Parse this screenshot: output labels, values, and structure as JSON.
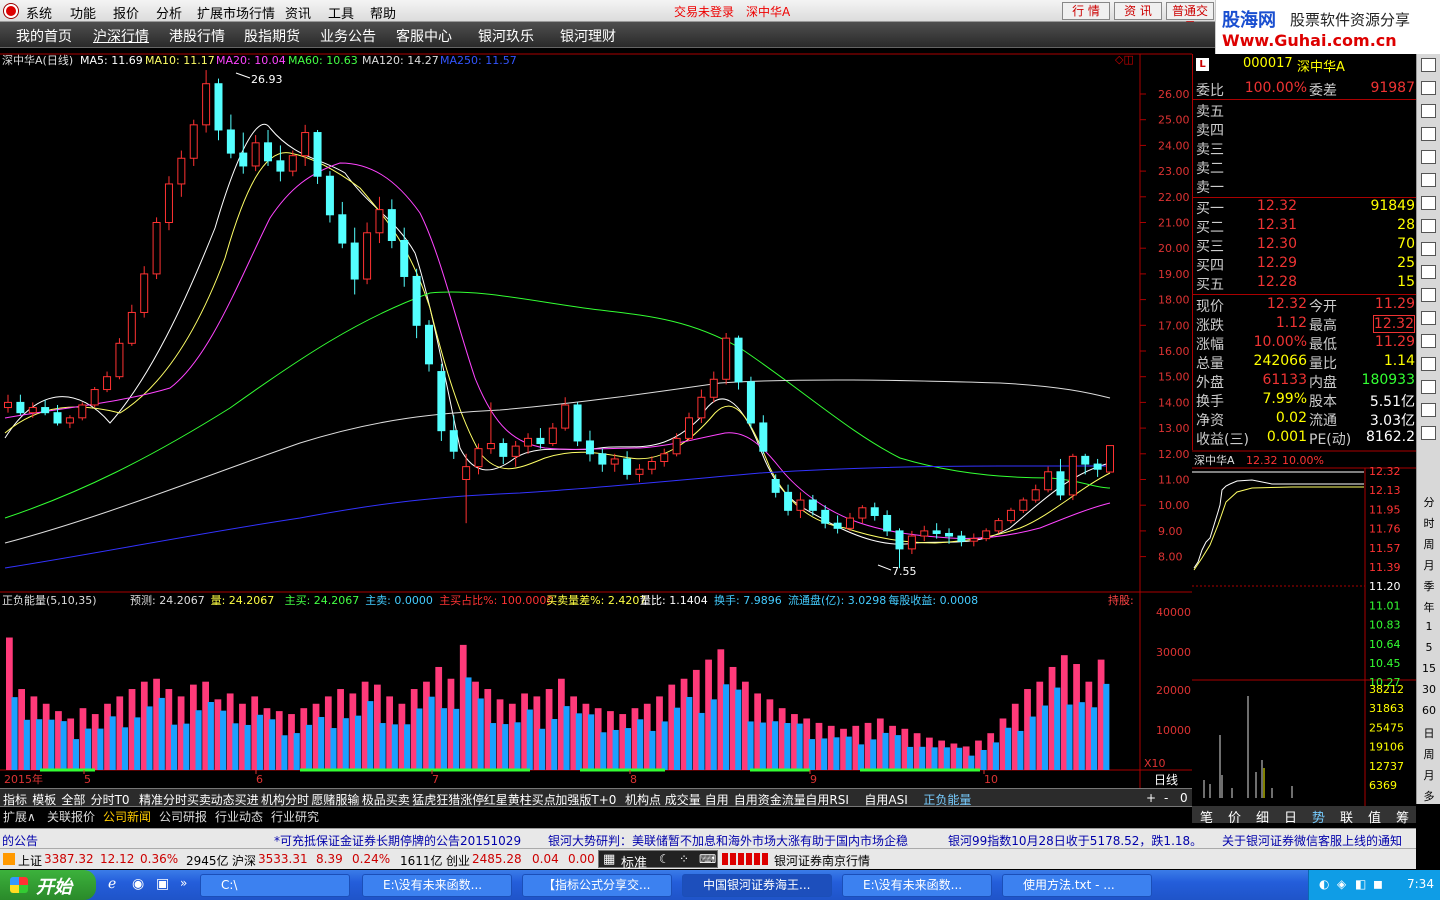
{
  "menubar": {
    "items": [
      "系统",
      "功能",
      "报价",
      "分析",
      "扩展市场行情",
      "资讯",
      "工具",
      "帮助"
    ],
    "trade_status": "交易未登录",
    "stock_name": "深中华A",
    "buttons": [
      "行 情",
      "资 讯",
      "普通交易"
    ]
  },
  "brand": {
    "name": "股海网",
    "slogan": "股票软件资源分享",
    "url": "Www.Guhai.com.cn"
  },
  "nav": {
    "items": [
      "我的首页",
      "沪深行情",
      "港股行情",
      "股指期货",
      "业务公告",
      "客服中心",
      "银河玖乐",
      "银河理财"
    ],
    "active": 1
  },
  "chart_header": {
    "title": "深中华A(日线)",
    "ma": [
      {
        "label": "MA5: 11.69",
        "color": "#ffffff"
      },
      {
        "label": "MA10: 11.17",
        "color": "#ffff66"
      },
      {
        "label": "MA20: 10.04",
        "color": "#ff44ff"
      },
      {
        "label": "MA60: 10.63",
        "color": "#44ff44"
      },
      {
        "label": "MA120: 14.27",
        "color": "#dddddd"
      },
      {
        "label": "MA250: 11.57",
        "color": "#3355ff"
      }
    ],
    "high_mark": "26.93",
    "low_mark": "7.55"
  },
  "price_axis": [
    "26.00",
    "25.00",
    "24.00",
    "23.00",
    "22.00",
    "21.00",
    "20.00",
    "19.00",
    "18.00",
    "17.00",
    "16.00",
    "15.00",
    "14.00",
    "13.00",
    "12.00",
    "11.00",
    "10.00",
    "9.00",
    "8.00"
  ],
  "vol_header": {
    "name": "正负能量(5,10,35)",
    "fields": [
      {
        "label": "预测: 24.2067",
        "color": "#dddddd"
      },
      {
        "label": "量: 24.2067",
        "color": "#ffff44"
      },
      {
        "label": "主买: 24.2067",
        "color": "#44ff44"
      },
      {
        "label": "主卖: 0.0000",
        "color": "#44ccff"
      },
      {
        "label": "主买占比%: 100.0000",
        "color": "#ff3333"
      },
      {
        "label": "买卖量差%: 2.4207",
        "color": "#ffff44"
      },
      {
        "label": "量比: 1.1404",
        "color": "#ffffff"
      },
      {
        "label": "换手: 7.9896",
        "color": "#44ccff"
      },
      {
        "label": "流通盘(亿): 3.0298",
        "color": "#44ccff"
      },
      {
        "label": "每股收益: 0.0008",
        "color": "#44ccff"
      }
    ],
    "hold_label": "持股:"
  },
  "vol_axis": [
    "40000",
    "30000",
    "20000",
    "10000"
  ],
  "vol_unit": "X10",
  "time_axis": [
    "2015年",
    "5",
    "6",
    "7",
    "8",
    "9",
    "10"
  ],
  "period_label": "日线",
  "quote": {
    "code": "000017",
    "name": "深中华A",
    "weibi_label": "委比",
    "weibi": "100.00%",
    "weicha_label": "委差",
    "weicha": "91987",
    "sell": [
      "卖五",
      "卖四",
      "卖三",
      "卖二",
      "卖一"
    ],
    "buy": [
      {
        "label": "买一",
        "price": "12.32",
        "vol": "91849"
      },
      {
        "label": "买二",
        "price": "12.31",
        "vol": "28"
      },
      {
        "label": "买三",
        "price": "12.30",
        "vol": "70"
      },
      {
        "label": "买四",
        "price": "12.29",
        "vol": "25"
      },
      {
        "label": "买五",
        "price": "12.28",
        "vol": "15"
      }
    ],
    "stats": [
      {
        "l1": "现价",
        "v1": "12.32",
        "l2": "今开",
        "v2": "11.29"
      },
      {
        "l1": "涨跌",
        "v1": "1.12",
        "l2": "最高",
        "v2": "12.32"
      },
      {
        "l1": "涨幅",
        "v1": "10.00%",
        "l2": "最低",
        "v2": "11.29"
      },
      {
        "l1": "总量",
        "v1": "242066",
        "l2": "量比",
        "v2": "1.14"
      },
      {
        "l1": "外盘",
        "v1": "61133",
        "l2": "内盘",
        "v2": "180933"
      },
      {
        "l1": "换手",
        "v1": "7.99%",
        "l2": "股本",
        "v2": "5.51亿"
      },
      {
        "l1": "净资",
        "v1": "0.02",
        "l2": "流通",
        "v2": "3.03亿"
      },
      {
        "l1": "收益(三)",
        "v1": "0.001",
        "l2": "PE(动)",
        "v2": "8162.2"
      }
    ]
  },
  "mini_chart": {
    "title": "深中华A",
    "price": "12.32",
    "pct": "10.00%",
    "axis": [
      "12.32",
      "12.13",
      "11.95",
      "11.76",
      "11.57",
      "11.39",
      "11.20",
      "11.01",
      "10.83",
      "10.64",
      "10.45",
      "10.27"
    ],
    "vol_axis": [
      "38212",
      "31863",
      "25475",
      "19106",
      "12737",
      "6369"
    ]
  },
  "right_tools": [
    "分",
    "时",
    "周",
    "月",
    "季",
    "年",
    "1",
    "5",
    "15",
    "30",
    "60",
    "日",
    "周",
    "月",
    "多",
    "季",
    "年"
  ],
  "tabs": [
    "指标",
    "模板",
    "全部",
    "分时T0",
    "精准分时买卖",
    "动态买进",
    "机构分时",
    "愿赌服输",
    "极品买卖",
    "猛虎狂猎涨停",
    "红星黄柱买点",
    "加强版T+0",
    "机构点",
    "成交量",
    "自用",
    "自用资金流量",
    "自用RSI",
    "自用ASI",
    "正负能量"
  ],
  "active_tab": "正负能量",
  "tab_controls": [
    "+",
    "-",
    "0"
  ],
  "tabs2": [
    "扩展∧",
    "关联报价",
    "公司新闻",
    "公司研报",
    "行业动态",
    "行业研究"
  ],
  "mini_tabs": [
    "笔",
    "价",
    "细",
    "日",
    "势",
    "联",
    "值",
    "筹"
  ],
  "news": [
    "的公告",
    "*可充抵保证金证券长期停牌的公告20151029",
    "银河大势研判：美联储暂不加息和海外市场大涨有助于国内市场企稳",
    "银河99指数10月28日收于5178.52，跌1.18。",
    "关于银河证券微信客服上线的通知"
  ],
  "index_bar": {
    "sh": {
      "name": "上证",
      "val": "3387.32",
      "chg": "12.12",
      "pct": "0.36%",
      "amt": "2945亿"
    },
    "hs": {
      "name": "沪深",
      "val": "3533.31",
      "chg": "8.39",
      "pct": "0.24%",
      "amt": "1611亿"
    },
    "cy": {
      "name": "创业",
      "val": "2485.28",
      "chg": "0.04",
      "pct": "0.00"
    },
    "mode": "标准",
    "broker": "银河证券南京行情"
  },
  "taskbar": {
    "start": "开始",
    "items": [
      "C:\\",
      "E:\\没有未来函数...",
      "【指标公式分享交...",
      "中国银河证券海王...",
      "E:\\没有未来函数...",
      "使用方法.txt - ..."
    ],
    "active": 3,
    "clock": "7:34"
  },
  "chart_data": {
    "type": "candlestick",
    "ylim": [
      7.3,
      27.5
    ],
    "candles": [
      [
        13.8,
        14.3,
        13.6,
        14.0
      ],
      [
        14.0,
        14.3,
        13.5,
        13.6
      ],
      [
        13.6,
        14.0,
        13.4,
        13.8
      ],
      [
        13.8,
        14.1,
        13.5,
        13.6
      ],
      [
        13.6,
        13.9,
        13.1,
        13.2
      ],
      [
        13.2,
        13.5,
        13.0,
        13.4
      ],
      [
        13.4,
        14.0,
        13.3,
        13.9
      ],
      [
        13.9,
        14.6,
        13.8,
        14.5
      ],
      [
        14.5,
        15.2,
        14.4,
        15.0
      ],
      [
        15.0,
        16.5,
        14.9,
        16.3
      ],
      [
        16.3,
        17.8,
        16.2,
        17.5
      ],
      [
        17.5,
        19.3,
        17.3,
        19.0
      ],
      [
        19.0,
        21.2,
        18.8,
        21.0
      ],
      [
        21.0,
        22.8,
        20.7,
        22.5
      ],
      [
        22.5,
        23.8,
        22.0,
        23.5
      ],
      [
        23.5,
        25.0,
        23.2,
        24.8
      ],
      [
        24.8,
        26.93,
        24.5,
        26.4
      ],
      [
        26.4,
        26.6,
        24.2,
        24.6
      ],
      [
        24.6,
        25.2,
        23.5,
        23.7
      ],
      [
        23.7,
        24.5,
        22.9,
        23.2
      ],
      [
        23.2,
        24.4,
        23.0,
        24.1
      ],
      [
        24.1,
        24.6,
        23.2,
        23.4
      ],
      [
        23.4,
        24.0,
        22.6,
        23.0
      ],
      [
        23.0,
        23.8,
        22.8,
        23.6
      ],
      [
        23.6,
        24.8,
        23.2,
        24.5
      ],
      [
        24.5,
        24.6,
        22.5,
        22.8
      ],
      [
        22.8,
        23.0,
        21.0,
        21.3
      ],
      [
        21.3,
        21.8,
        20.0,
        20.2
      ],
      [
        20.2,
        20.8,
        18.2,
        18.8
      ],
      [
        18.8,
        21.0,
        18.6,
        20.6
      ],
      [
        20.6,
        22.0,
        20.2,
        21.5
      ],
      [
        21.5,
        21.9,
        20.0,
        20.3
      ],
      [
        20.3,
        20.8,
        18.5,
        18.9
      ],
      [
        18.9,
        19.2,
        16.5,
        17.0
      ],
      [
        17.0,
        17.2,
        15.2,
        15.5
      ],
      [
        15.2,
        15.5,
        12.5,
        12.9
      ],
      [
        12.9,
        13.5,
        11.8,
        12.1
      ],
      [
        11.0,
        12.0,
        9.3,
        11.5
      ],
      [
        11.5,
        12.4,
        11.2,
        12.2
      ],
      [
        12.2,
        14.0,
        12.0,
        12.4
      ],
      [
        12.4,
        12.6,
        11.6,
        11.9
      ],
      [
        11.9,
        12.5,
        11.5,
        12.3
      ],
      [
        12.3,
        12.8,
        12.0,
        12.6
      ],
      [
        12.6,
        13.0,
        12.2,
        12.4
      ],
      [
        12.4,
        13.2,
        12.3,
        13.0
      ],
      [
        13.0,
        14.2,
        12.9,
        13.9
      ],
      [
        13.9,
        14.0,
        12.3,
        12.5
      ],
      [
        12.5,
        12.9,
        11.7,
        12.0
      ],
      [
        12.0,
        12.2,
        11.3,
        11.6
      ],
      [
        11.6,
        12.0,
        11.3,
        11.8
      ],
      [
        11.8,
        12.1,
        11.0,
        11.2
      ],
      [
        11.2,
        11.6,
        10.9,
        11.4
      ],
      [
        11.4,
        11.9,
        11.2,
        11.7
      ],
      [
        11.7,
        12.2,
        11.5,
        12.0
      ],
      [
        12.0,
        12.8,
        11.9,
        12.6
      ],
      [
        12.6,
        13.6,
        12.5,
        13.4
      ],
      [
        13.4,
        14.5,
        13.2,
        14.2
      ],
      [
        14.2,
        15.2,
        14.0,
        14.9
      ],
      [
        14.9,
        16.7,
        14.7,
        16.5
      ],
      [
        16.5,
        16.6,
        14.5,
        14.8
      ],
      [
        14.8,
        15.0,
        13.0,
        13.2
      ],
      [
        13.2,
        13.5,
        12.0,
        12.1
      ],
      [
        11.0,
        11.2,
        10.3,
        10.5
      ],
      [
        10.5,
        10.8,
        9.6,
        9.8
      ],
      [
        9.8,
        10.5,
        9.5,
        10.2
      ],
      [
        10.2,
        10.4,
        9.6,
        9.8
      ],
      [
        9.8,
        10.0,
        9.1,
        9.3
      ],
      [
        9.3,
        9.6,
        8.9,
        9.1
      ],
      [
        9.1,
        9.7,
        9.0,
        9.5
      ],
      [
        9.5,
        10.0,
        9.3,
        9.9
      ],
      [
        9.9,
        10.1,
        9.4,
        9.6
      ],
      [
        9.6,
        9.8,
        8.8,
        9.0
      ],
      [
        9.0,
        9.1,
        7.55,
        8.3
      ],
      [
        8.3,
        9.0,
        8.1,
        8.8
      ],
      [
        8.8,
        9.2,
        8.6,
        9.0
      ],
      [
        9.0,
        9.3,
        8.7,
        8.9
      ],
      [
        8.9,
        9.1,
        8.5,
        8.8
      ],
      [
        8.8,
        9.0,
        8.4,
        8.6
      ],
      [
        8.6,
        8.9,
        8.4,
        8.7
      ],
      [
        8.7,
        9.1,
        8.6,
        9.0
      ],
      [
        9.0,
        9.5,
        8.9,
        9.4
      ],
      [
        9.4,
        9.9,
        9.3,
        9.8
      ],
      [
        9.8,
        10.3,
        9.7,
        10.2
      ],
      [
        10.2,
        10.8,
        10.1,
        10.6
      ],
      [
        10.6,
        11.5,
        10.5,
        11.3
      ],
      [
        11.3,
        11.8,
        10.2,
        10.4
      ],
      [
        10.4,
        12.0,
        10.2,
        11.9
      ],
      [
        11.9,
        12.0,
        11.2,
        11.6
      ],
      [
        11.6,
        11.8,
        11.1,
        11.4
      ],
      [
        11.29,
        12.32,
        11.29,
        12.32
      ]
    ]
  }
}
